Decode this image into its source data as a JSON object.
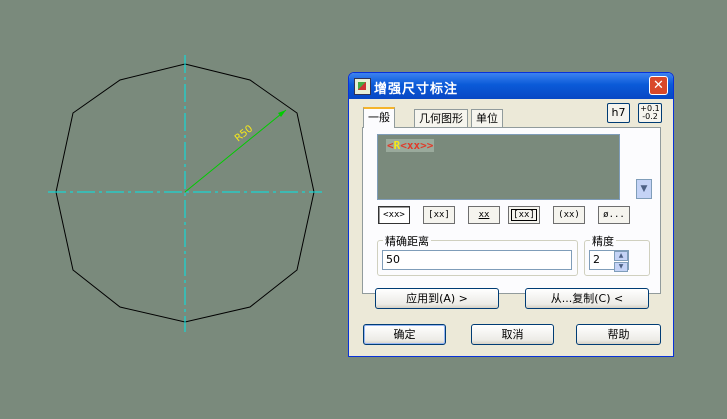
{
  "dialog": {
    "title": "增强尺寸标注",
    "close_glyph": "✕",
    "tabs": [
      {
        "label": "一般",
        "active": true
      },
      {
        "label": "几何图形",
        "active": false
      },
      {
        "label": "单位",
        "active": false
      }
    ],
    "tolerance_buttons": {
      "fit_label": "h7",
      "dev_upper": "+0.1",
      "dev_lower": "-0.2"
    },
    "edit_text": {
      "open": "<",
      "prefix": "R",
      "body": "<xx>",
      "close": ">"
    },
    "format_buttons": [
      "<xx>",
      "[xx]",
      "xx",
      "[xx]",
      "(xx)",
      "ø..."
    ],
    "precise_distance": {
      "label": "精确距离",
      "value": "50"
    },
    "precision": {
      "label": "精度",
      "value": "2"
    },
    "apply_to_button": "应用到(A) >",
    "copy_from_button": "从...复制(C) <",
    "ok_button": "确定",
    "cancel_button": "取消",
    "help_button": "帮助"
  },
  "drawing": {
    "dimension_label": "R50",
    "colors": {
      "outline": "#000000",
      "centerline": "#00e8e8",
      "dimension": "#00cc00",
      "text": "#f6e81a"
    }
  }
}
